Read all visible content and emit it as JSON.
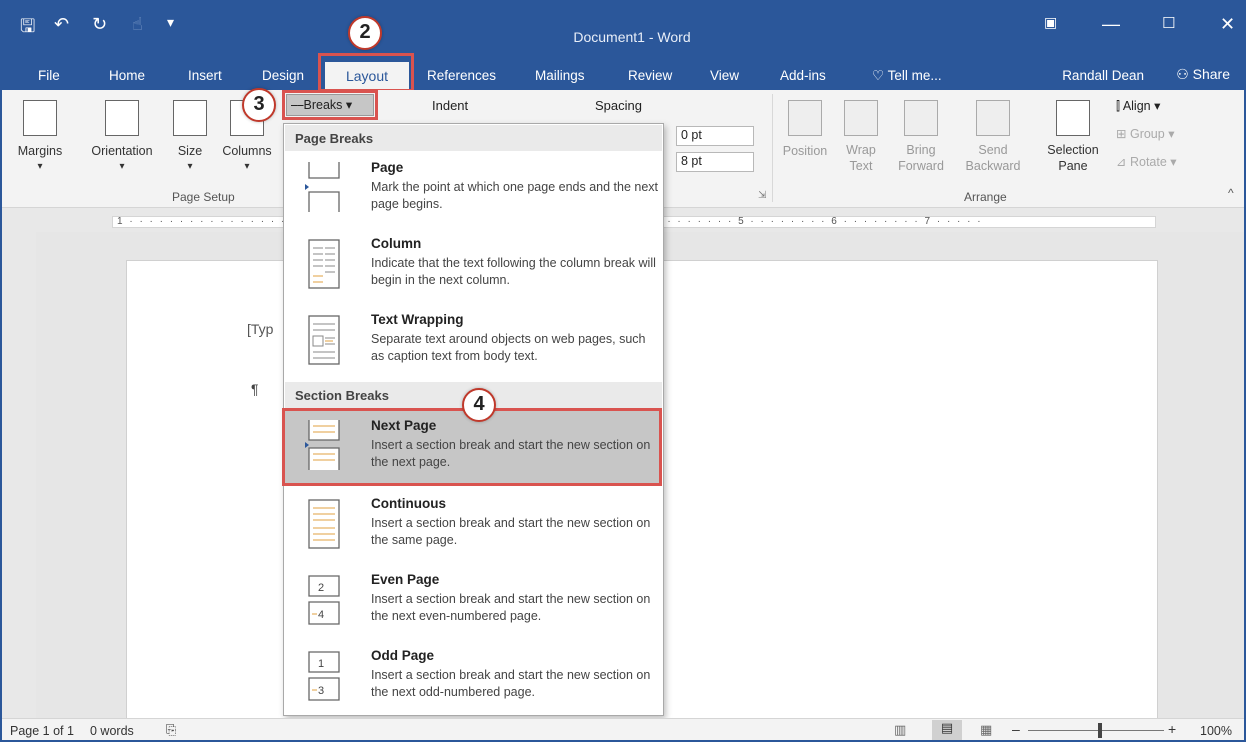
{
  "window": {
    "title": "Document1 - Word"
  },
  "user": {
    "name": "Randall Dean",
    "share_label": "Share"
  },
  "tabs": [
    "File",
    "Home",
    "Insert",
    "Design",
    "Layout",
    "References",
    "Mailings",
    "Review",
    "View",
    "Add-ins",
    "Tell me..."
  ],
  "ribbon": {
    "page_setup": {
      "margins": "Margins",
      "orientation": "Orientation",
      "size": "Size",
      "columns": "Columns",
      "breaks": "Breaks",
      "group": "Page Setup"
    },
    "paragraph": {
      "indent": "Indent",
      "spacing": "Spacing",
      "before": "0 pt",
      "after": "8 pt"
    },
    "arrange": {
      "position": "Position",
      "wrap_text_1": "Wrap",
      "wrap_text_2": "Text",
      "bring_forward_1": "Bring",
      "bring_forward_2": "Forward",
      "send_backward_1": "Send",
      "send_backward_2": "Backward",
      "selection_pane_1": "Selection",
      "selection_pane_2": "Pane",
      "align": "Align",
      "group": "Group",
      "rotate": "Rotate",
      "group_label": "Arrange"
    }
  },
  "ruler": {
    "ticks": "1 · · · · · · · · · · · · · · · · · · · · · · · · · · · · · · · · · · · · · · · · · · · · · · · · · · · 4 · · · · · · · · 5 · · · · · · · · 6 · · · · · · · · 7 · · · · ·"
  },
  "document": {
    "placeholder": "[Typ",
    "pilcrow": "¶"
  },
  "breaks_menu": {
    "page_breaks_header": "Page Breaks",
    "section_breaks_header": "Section Breaks",
    "page": {
      "title": "Page",
      "desc": "Mark the point at which one page ends and the next page begins."
    },
    "column": {
      "title": "Column",
      "desc": "Indicate that the text following the column break will begin in the next column."
    },
    "text_wrapping": {
      "title": "Text Wrapping",
      "desc": "Separate text around objects on web pages, such as caption text from body text."
    },
    "next_page": {
      "title": "Next Page",
      "desc": "Insert a section break and start the new section on the next page."
    },
    "continuous": {
      "title": "Continuous",
      "desc": "Insert a section break and start the new section on the same page."
    },
    "even_page": {
      "title": "Even Page",
      "desc": "Insert a section break and start the new section on the next even-numbered page."
    },
    "odd_page": {
      "title": "Odd Page",
      "desc": "Insert a section break and start the new section on the next odd-numbered page."
    }
  },
  "callouts": [
    "2",
    "3",
    "4"
  ],
  "status": {
    "page": "Page 1 of 1",
    "words": "0 words",
    "zoom": "100%"
  },
  "colors": {
    "brand": "#2b579a",
    "highlight": "#d9534f",
    "selected": "#c6c6c6"
  }
}
